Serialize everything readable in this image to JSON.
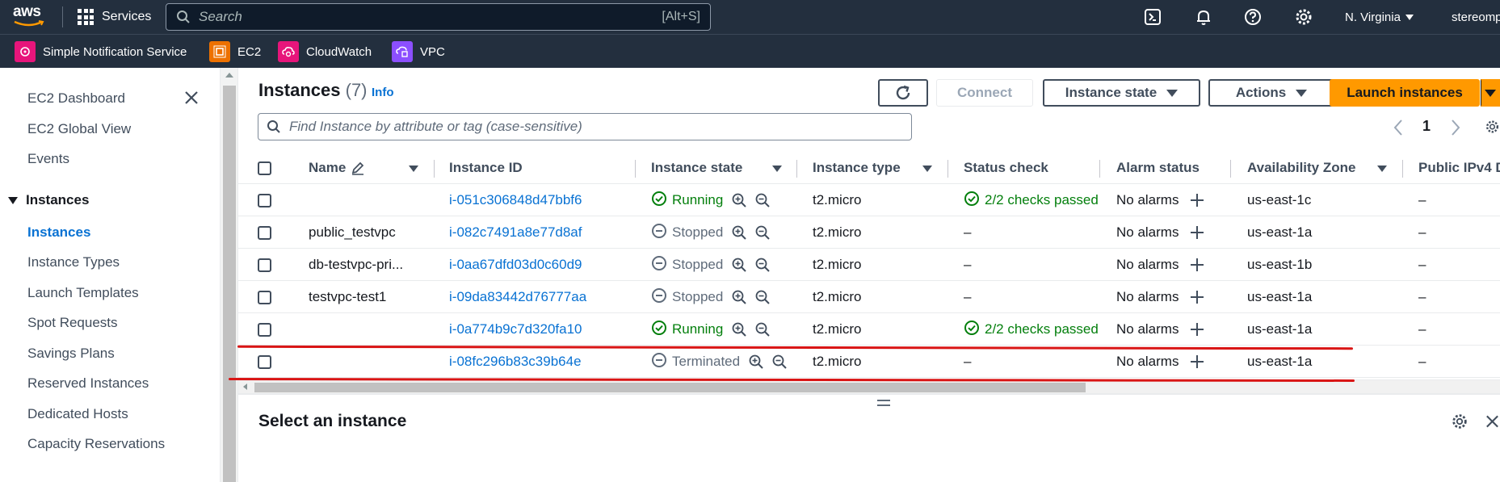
{
  "topnav": {
    "logo": "aws",
    "services": "Services",
    "search_placeholder": "Search",
    "search_shortcut": "[Alt+S]",
    "region": "N. Virginia",
    "user": "stereomp"
  },
  "favorites": [
    {
      "label": "Simple Notification Service",
      "color": "#e7157b"
    },
    {
      "label": "EC2",
      "color": "#ed7100"
    },
    {
      "label": "CloudWatch",
      "color": "#e7157b"
    },
    {
      "label": "VPC",
      "color": "#8c4fff"
    }
  ],
  "sidebar": {
    "items_top": [
      "EC2 Dashboard",
      "EC2 Global View",
      "Events"
    ],
    "section": "Instances",
    "items": [
      "Instances",
      "Instance Types",
      "Launch Templates",
      "Spot Requests",
      "Savings Plans",
      "Reserved Instances",
      "Dedicated Hosts",
      "Capacity Reservations"
    ]
  },
  "main": {
    "title": "Instances",
    "count": "(7)",
    "info": "Info",
    "connect": "Connect",
    "instance_state": "Instance state",
    "actions": "Actions",
    "launch": "Launch instances",
    "filter_placeholder": "Find Instance by attribute or tag (case-sensitive)",
    "page": "1",
    "select_title": "Select an instance"
  },
  "table": {
    "columns": [
      "Name",
      "Instance ID",
      "Instance state",
      "Instance type",
      "Status check",
      "Alarm status",
      "Availability Zone",
      "Public IPv4 D"
    ],
    "rows": [
      {
        "name": "",
        "id": "i-051c306848d47bbf6",
        "state": "Running",
        "type": "t2.micro",
        "check": "2/2 checks passed",
        "alarm": "No alarms",
        "az": "us-east-1c",
        "ip": "–"
      },
      {
        "name": "public_testvpc",
        "id": "i-082c7491a8e77d8af",
        "state": "Stopped",
        "type": "t2.micro",
        "check": "–",
        "alarm": "No alarms",
        "az": "us-east-1a",
        "ip": "–"
      },
      {
        "name": "db-testvpc-pri...",
        "id": "i-0aa67dfd03d0c60d9",
        "state": "Stopped",
        "type": "t2.micro",
        "check": "–",
        "alarm": "No alarms",
        "az": "us-east-1b",
        "ip": "–"
      },
      {
        "name": "testvpc-test1",
        "id": "i-09da83442d76777aa",
        "state": "Stopped",
        "type": "t2.micro",
        "check": "–",
        "alarm": "No alarms",
        "az": "us-east-1a",
        "ip": "–"
      },
      {
        "name": "",
        "id": "i-0a774b9c7d320fa10",
        "state": "Running",
        "type": "t2.micro",
        "check": "2/2 checks passed",
        "alarm": "No alarms",
        "az": "us-east-1a",
        "ip": "–"
      },
      {
        "name": "",
        "id": "i-08fc296b83c39b64e",
        "state": "Terminated",
        "type": "t2.micro",
        "check": "–",
        "alarm": "No alarms",
        "az": "us-east-1a",
        "ip": "–"
      }
    ]
  },
  "colors": {
    "nav": "#232f3e",
    "link": "#0972d3",
    "success": "#037f0c",
    "primary": "#ff9900",
    "annotation": "#d91515"
  }
}
